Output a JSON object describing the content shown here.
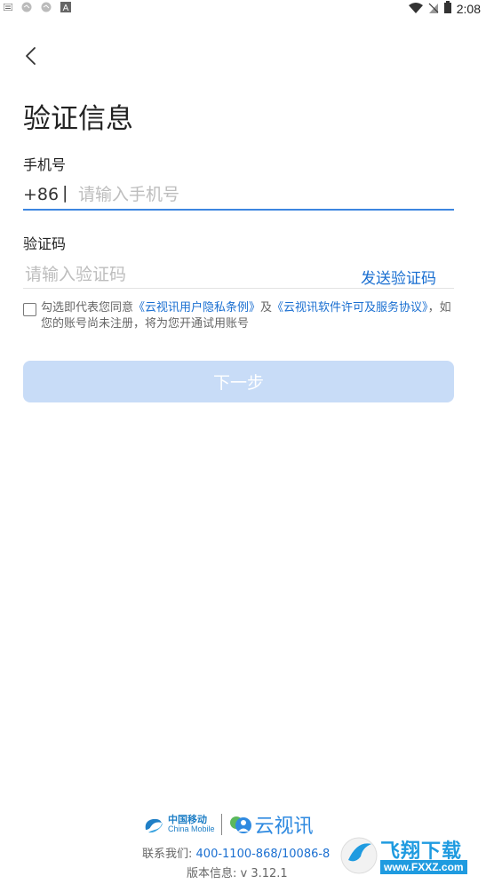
{
  "status_bar": {
    "time": "2:08",
    "left_icons": [
      "keyboard-icon",
      "notification-icon",
      "notification-icon",
      "a-icon"
    ],
    "right_icons": [
      "wifi-icon",
      "no-sim-icon",
      "battery-icon"
    ]
  },
  "header": {
    "back_icon": "chevron-left-icon"
  },
  "page_title": "验证信息",
  "phone": {
    "label": "手机号",
    "prefix": "+86",
    "separator": "|",
    "placeholder": "请输入手机号",
    "value": ""
  },
  "code": {
    "label": "验证码",
    "placeholder": "请输入验证码",
    "value": "",
    "send_label": "发送验证码"
  },
  "agreement": {
    "checked": false,
    "prefix": "勾选即代表您同意",
    "privacy_link": "《云视讯用户隐私条例》",
    "and": "及",
    "license_link": "《云视讯软件许可及服务协议》",
    "suffix": "，如您的账号尚未注册，将为您开通试用账号"
  },
  "next_button": "下一步",
  "footer": {
    "china_mobile_cn": "中国移动",
    "china_mobile_en": "China Mobile",
    "app_name": "云视讯",
    "contact_label": "联系我们:",
    "contact_numbers": "400-1100-868/10086-8",
    "version": "版本信息: v 3.12.1"
  },
  "watermark": {
    "title": "飞翔下载",
    "url": "www.FXXZ.com"
  },
  "colors": {
    "accent": "#1a6fd1",
    "input_focus": "#3d86e0",
    "button_disabled": "#c8dcf7",
    "logo_blue": "#2f8ae0"
  }
}
